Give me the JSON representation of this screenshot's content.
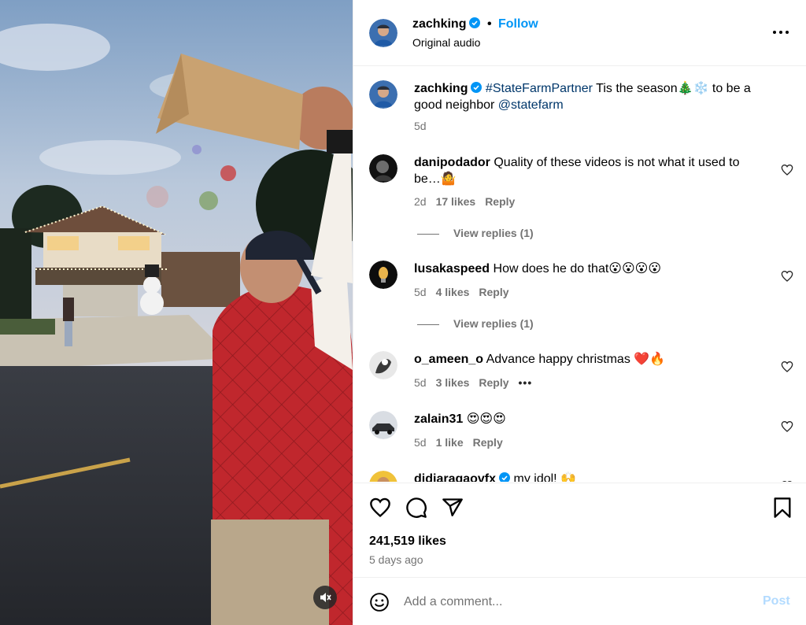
{
  "colors": {
    "accent": "#0095f6",
    "link": "#00376b",
    "muted": "#737373",
    "heart": "#ed4956",
    "vest": "#c0272d"
  },
  "header": {
    "username": "zachking",
    "separator": "•",
    "follow_label": "Follow",
    "subtitle": "Original audio"
  },
  "caption": {
    "username": "zachking",
    "hashtag": "#StateFarmPartner",
    "text": " Tis the season🎄❄️ to be a good neighbor ",
    "mention": "@statefarm",
    "time": "5d"
  },
  "comments": [
    {
      "username": "danipodador",
      "text": "Quality of these videos is not what it used to be…🤷",
      "time": "2d",
      "likes": "17 likes",
      "reply": "Reply",
      "view_replies": "View replies (1)"
    },
    {
      "username": "lusakaspeed",
      "text": "How does he do that😮😮😮😮",
      "time": "5d",
      "likes": "4 likes",
      "reply": "Reply",
      "view_replies": "View replies (1)"
    },
    {
      "username": "o_ameen_o",
      "text": "Advance happy christmas ❤️🔥",
      "time": "5d",
      "likes": "3 likes",
      "reply": "Reply",
      "more": "•••"
    },
    {
      "username": "zalain31",
      "text": "😍😍😍",
      "time": "5d",
      "likes": "1 like",
      "reply": "Reply"
    },
    {
      "username": "didiaragaovfx",
      "text": "my idol! 🙌"
    }
  ],
  "post": {
    "likes": "241,519 likes",
    "ago": "5 days ago"
  },
  "composer": {
    "placeholder": "Add a comment...",
    "post_label": "Post"
  },
  "icons": [
    "verified-badge-icon",
    "more-options-icon",
    "heart-icon",
    "comment-icon",
    "share-icon",
    "bookmark-icon",
    "emoji-icon",
    "mute-icon"
  ]
}
